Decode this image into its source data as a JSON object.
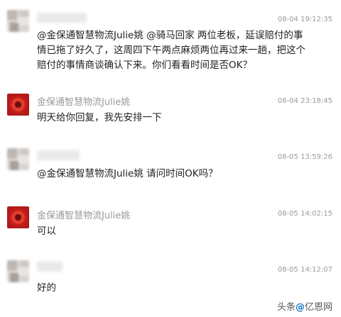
{
  "messages": [
    {
      "sender": "",
      "time": "08-04 19:12:35",
      "lines": [
        "@金保通智慧物流Julie姚 @骑马回家 两位老板，延误赔付的事",
        "情已拖了好久了，这周四下午两点麻烦两位再过来一趟，把这个",
        "赔付的事情商谈确认下来。你们看看时间是否OK？"
      ]
    },
    {
      "sender": "金保通智慧物流Julie姚",
      "time": "08-04 23:18:45",
      "lines": [
        "明天给你回复，我先安排一下"
      ]
    },
    {
      "sender": "",
      "time": "08-05 13:59:26",
      "lines": [
        "@金保通智慧物流Julie姚 请问时间OK吗？"
      ]
    },
    {
      "sender": "金保通智慧物流Julie姚",
      "time": "08-05 14:02:15",
      "lines": [
        "可以"
      ]
    },
    {
      "sender": "",
      "time": "08-05 14:12:07",
      "lines": [
        "好的"
      ]
    }
  ],
  "watermark": {
    "prefix": "头条",
    "middle": "@",
    "brand": "亿恩网"
  }
}
